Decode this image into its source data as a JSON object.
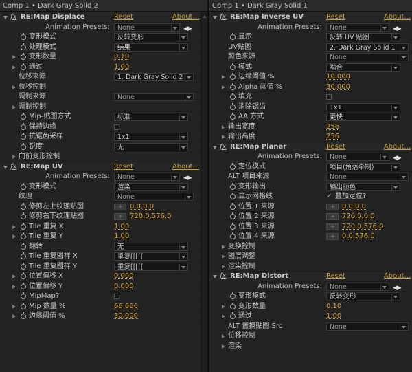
{
  "left": {
    "header": "Comp 1 • Dark Gray Solid 2",
    "effects": [
      {
        "name": "RE:Map Displace",
        "reset": "Reset",
        "about": "About...",
        "presets_label": "Animation Presets:",
        "presets_value": "None",
        "params": [
          {
            "label": "变形模式",
            "type": "dropdown",
            "value": "反转变形",
            "stopwatch": true,
            "twirl": false
          },
          {
            "label": "处理模式",
            "type": "dropdown",
            "value": "结果",
            "stopwatch": true,
            "twirl": false
          },
          {
            "label": "变形数量",
            "type": "number",
            "value": "0.10",
            "stopwatch": true,
            "twirl": true
          },
          {
            "label": "通过",
            "type": "number",
            "value": "1.00",
            "stopwatch": true,
            "twirl": true
          },
          {
            "label": "位移来源",
            "type": "dropdown",
            "value": "1. Dark Gray Solid 2",
            "stopwatch": false,
            "twirl": false
          },
          {
            "label": "位移控制",
            "type": "group",
            "stopwatch": false,
            "twirl": true
          },
          {
            "label": "调制来源",
            "type": "dropdown",
            "value": "None",
            "stopwatch": false,
            "twirl": false
          },
          {
            "label": "调制控制",
            "type": "group",
            "stopwatch": false,
            "twirl": true
          },
          {
            "label": "Mip-贴图方式",
            "type": "dropdown",
            "value": "标准",
            "stopwatch": true,
            "twirl": false
          },
          {
            "label": "保持边缘",
            "type": "checkbox",
            "checked": false,
            "stopwatch": true,
            "twirl": false
          },
          {
            "label": "抗锯齿采样",
            "type": "dropdown",
            "value": "1x1",
            "stopwatch": true,
            "twirl": false
          },
          {
            "label": "锐度",
            "type": "dropdown",
            "value": "无",
            "stopwatch": true,
            "twirl": false
          },
          {
            "label": "向前变形控制",
            "type": "group",
            "stopwatch": false,
            "twirl": true
          }
        ]
      },
      {
        "name": "RE:Map UV",
        "reset": "Reset",
        "about": "About...",
        "presets_label": "Animation Presets:",
        "presets_value": "None",
        "params": [
          {
            "label": "变形模式",
            "type": "dropdown",
            "value": "渲染",
            "stopwatch": true,
            "twirl": false
          },
          {
            "label": "纹理",
            "type": "dropdown",
            "value": "None",
            "stopwatch": false,
            "twirl": false
          },
          {
            "label": "修剪左上纹理贴图",
            "type": "point",
            "value": "0.0,0.0",
            "stopwatch": true,
            "twirl": false
          },
          {
            "label": "修剪右下纹理贴图",
            "type": "point",
            "value": "720.0,576.0",
            "stopwatch": true,
            "twirl": false
          },
          {
            "label": "Tile 重复 X",
            "type": "number",
            "value": "1.00",
            "stopwatch": true,
            "twirl": true
          },
          {
            "label": "Tile 重复 Y",
            "type": "number",
            "value": "1.00",
            "stopwatch": true,
            "twirl": true
          },
          {
            "label": "翻转",
            "type": "dropdown",
            "value": "无",
            "stopwatch": true,
            "twirl": false
          },
          {
            "label": "Tile 重复图样 X",
            "type": "dropdown",
            "value": "重复[[[[[",
            "stopwatch": true,
            "twirl": false
          },
          {
            "label": "Tile 重复图样 Y",
            "type": "dropdown",
            "value": "重复[[[[[",
            "stopwatch": true,
            "twirl": false
          },
          {
            "label": "位置偏移 X",
            "type": "number",
            "value": "0.000",
            "stopwatch": true,
            "twirl": true
          },
          {
            "label": "位置偏移 Y",
            "type": "number",
            "value": "0.000",
            "stopwatch": true,
            "twirl": true
          },
          {
            "label": "MipMap?",
            "type": "checkbox",
            "checked": false,
            "stopwatch": true,
            "twirl": false
          },
          {
            "label": "Mip 数量 %",
            "type": "number",
            "value": "66.660",
            "stopwatch": true,
            "twirl": true
          },
          {
            "label": "边缘阈值 %",
            "type": "number",
            "value": "30.000",
            "stopwatch": true,
            "twirl": true
          }
        ]
      }
    ]
  },
  "right": {
    "header": "Comp 1 • Dark Gray Solid 1",
    "effects": [
      {
        "name": "RE:Map Inverse UV",
        "reset": "Reset",
        "about": "About...",
        "presets_label": "Animation Presets:",
        "presets_value": "None",
        "params": [
          {
            "label": "显示",
            "type": "dropdown",
            "value": "反转 UV 贴图",
            "stopwatch": true,
            "twirl": false
          },
          {
            "label": "UV贴图",
            "type": "dropdown",
            "value": "2. Dark Gray Solid 1",
            "stopwatch": false,
            "twirl": false
          },
          {
            "label": "颜色来源",
            "type": "dropdown",
            "value": "None",
            "stopwatch": false,
            "twirl": false
          },
          {
            "label": "模式",
            "type": "dropdown",
            "value": "啮合",
            "stopwatch": true,
            "twirl": false
          },
          {
            "label": "边缘阈值 %",
            "type": "number",
            "value": "10.000",
            "stopwatch": true,
            "twirl": true
          },
          {
            "label": "Alpha 阈值 %",
            "type": "number",
            "value": "30.000",
            "stopwatch": true,
            "twirl": true
          },
          {
            "label": "填充",
            "type": "checkbox",
            "checked": false,
            "stopwatch": true,
            "twirl": false
          },
          {
            "label": "消除锯齿",
            "type": "dropdown",
            "value": "1x1",
            "stopwatch": true,
            "twirl": false
          },
          {
            "label": "AA 方式",
            "type": "dropdown",
            "value": "更快",
            "stopwatch": true,
            "twirl": false
          },
          {
            "label": "输出宽度",
            "type": "number",
            "value": "256",
            "stopwatch": false,
            "twirl": true
          },
          {
            "label": "输出高度",
            "type": "number",
            "value": "256",
            "stopwatch": false,
            "twirl": true
          }
        ]
      },
      {
        "name": "RE:Map Planar",
        "reset": "Reset",
        "about": "About...",
        "presets_label": "Animation Presets:",
        "presets_value": "None",
        "params": [
          {
            "label": "定位模式",
            "type": "dropdown",
            "value": "项目(角落牵制)",
            "stopwatch": true,
            "twirl": false
          },
          {
            "label": "ALT 项目来源",
            "type": "dropdown",
            "value": "None",
            "stopwatch": false,
            "twirl": false
          },
          {
            "label": "变形输出",
            "type": "dropdown",
            "value": "输出颜色",
            "stopwatch": true,
            "twirl": false
          },
          {
            "label": "显示网格线",
            "type": "checkbox",
            "checked": true,
            "check_label": "叠加定位?",
            "stopwatch": true,
            "twirl": false
          },
          {
            "label": "位置 1 来源",
            "type": "point",
            "value": "0.0,0.0",
            "stopwatch": true,
            "twirl": false
          },
          {
            "label": "位置 2 来源",
            "type": "point",
            "value": "720.0,0.0",
            "stopwatch": true,
            "twirl": false
          },
          {
            "label": "位置 3 来源",
            "type": "point",
            "value": "720.0,576.0",
            "stopwatch": true,
            "twirl": false
          },
          {
            "label": "位置 4 来源",
            "type": "point",
            "value": "0.0,576.0",
            "stopwatch": true,
            "twirl": false
          },
          {
            "label": "变换控制",
            "type": "group",
            "stopwatch": false,
            "twirl": true
          },
          {
            "label": "图层调整",
            "type": "group",
            "stopwatch": false,
            "twirl": true
          },
          {
            "label": "渲染控制",
            "type": "group",
            "stopwatch": false,
            "twirl": true
          }
        ]
      },
      {
        "name": "RE:Map Distort",
        "reset": "Reset",
        "about": "About...",
        "presets_label": "Animation Presets:",
        "presets_value": "None",
        "params": [
          {
            "label": "变形模式",
            "type": "dropdown",
            "value": "反转变形",
            "stopwatch": true,
            "twirl": false
          },
          {
            "label": "变形数量",
            "type": "number",
            "value": "0.10",
            "stopwatch": true,
            "twirl": true
          },
          {
            "label": "通过",
            "type": "number",
            "value": "1.00",
            "stopwatch": true,
            "twirl": true
          },
          {
            "label": "ALT 置换贴图 Src",
            "type": "dropdown",
            "value": "None",
            "stopwatch": false,
            "twirl": false
          },
          {
            "label": "位移控制",
            "type": "group",
            "stopwatch": false,
            "twirl": true
          },
          {
            "label": "渲染",
            "type": "group",
            "stopwatch": false,
            "twirl": true
          }
        ]
      }
    ]
  },
  "colors": {
    "accent_value": "#d59e35",
    "link": "#c49a3c",
    "panel_bg": "#232323"
  }
}
